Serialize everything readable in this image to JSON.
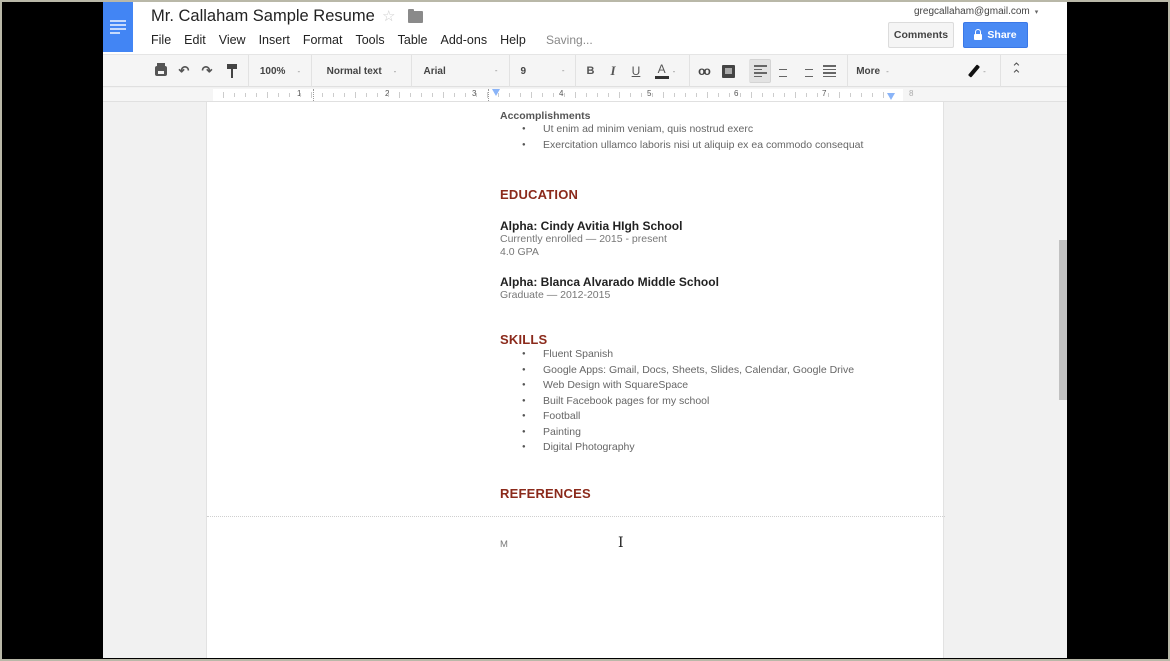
{
  "header": {
    "title": "Mr. Callaham Sample Resume",
    "star_icon": "star-outline-icon",
    "folder_icon": "folder-icon",
    "menu": [
      "File",
      "Edit",
      "View",
      "Insert",
      "Format",
      "Tools",
      "Table",
      "Add-ons",
      "Help"
    ],
    "save_status": "Saving...",
    "account_email": "gregcallaham@gmail.com",
    "account_caret": "▾",
    "comments_label": "Comments",
    "share_label": "Share",
    "accent_color": "#4285f4"
  },
  "toolbar": {
    "zoom": "100%",
    "style": "Normal text",
    "font": "Arial",
    "size": "9",
    "bold": "B",
    "italic": "I",
    "underline": "U",
    "text_color": "A",
    "more_label": "More",
    "caret": "-",
    "undo": "↶",
    "redo": "↷",
    "link": "oo",
    "collapse": "⌃"
  },
  "ruler": {
    "numbers": [
      "1",
      "2",
      "3",
      "4",
      "5",
      "6",
      "7",
      "8"
    ]
  },
  "document": {
    "accomplishments": {
      "heading": "Accomplishments",
      "items": [
        "Ut enim ad minim veniam, quis nostrud exerc",
        "Exercitation ullamco laboris nisi ut aliquip ex ea commodo consequat"
      ]
    },
    "education": {
      "heading": "EDUCATION",
      "schools": [
        {
          "name": "Alpha: Cindy Avitia HIgh School",
          "details": [
            "Currently enrolled — 2015 - present",
            "4.0 GPA"
          ]
        },
        {
          "name": "Alpha: Blanca Alvarado Middle School",
          "details": [
            "Graduate — 2012-2015"
          ]
        }
      ]
    },
    "skills": {
      "heading": "SKILLS",
      "items": [
        "Fluent Spanish",
        "Google Apps: Gmail, Docs, Sheets, Slides, Calendar, Google Drive",
        "Web Design with SquareSpace",
        "Built Facebook pages for my school",
        "Football",
        "Painting",
        "Digital Photography"
      ]
    },
    "references": {
      "heading": "REFERENCES",
      "typed_text": "M"
    },
    "heading_color": "#8b2a1b",
    "cursor": "I"
  }
}
